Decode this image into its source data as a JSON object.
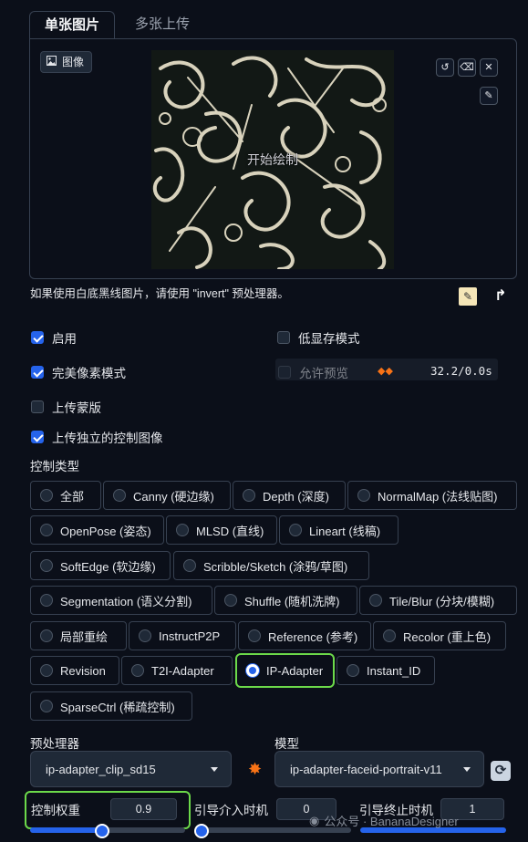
{
  "tabs": {
    "single": "单张图片",
    "multi": "多张上传"
  },
  "image_panel": {
    "label": "图像",
    "canvas_text": "开始绘制"
  },
  "note": "如果使用白底黑线图片，请使用 \"invert\" 预处理器。",
  "checkboxes": {
    "enable": {
      "label": "启用",
      "checked": true
    },
    "low_vram": {
      "label": "低显存模式",
      "checked": false
    },
    "pixel_perfect": {
      "label": "完美像素模式",
      "checked": true
    },
    "allow_preview": {
      "label": "允许预览",
      "checked": false
    },
    "upload_mask": {
      "label": "上传蒙版",
      "checked": false
    },
    "upload_independent": {
      "label": "上传独立的控制图像",
      "checked": true
    }
  },
  "preview_stat": "32.2/0.0s",
  "control_type": {
    "title": "控制类型",
    "options": [
      "全部",
      "Canny (硬边缘)",
      "Depth (深度)",
      "NormalMap (法线贴图)",
      "OpenPose (姿态)",
      "MLSD (直线)",
      "Lineart (线稿)",
      "SoftEdge (软边缘)",
      "Scribble/Sketch (涂鸦/草图)",
      "Segmentation (语义分割)",
      "Shuffle (随机洗牌)",
      "Tile/Blur (分块/模糊)",
      "局部重绘",
      "InstructP2P",
      "Reference (参考)",
      "Recolor (重上色)",
      "Revision",
      "T2I-Adapter",
      "IP-Adapter",
      "Instant_ID",
      "SparseCtrl (稀疏控制)"
    ],
    "selected": "IP-Adapter"
  },
  "preprocessor": {
    "label": "预处理器",
    "value": "ip-adapter_clip_sd15"
  },
  "model": {
    "label": "模型",
    "value": "ip-adapter-faceid-portrait-v11"
  },
  "weight": {
    "label": "控制权重",
    "value": "0.9",
    "fraction": 0.45
  },
  "start": {
    "label": "引导介入时机",
    "value": "0",
    "fraction": 0.0
  },
  "end": {
    "label": "引导终止时机",
    "value": "1",
    "fraction": 1.0
  },
  "watermark": "公众号 · BananaDesigner",
  "colors": {
    "accent": "#2563eb",
    "highlight": "#6cd94a",
    "background": "#0b0f19"
  },
  "icons": [
    "image-icon",
    "undo-icon",
    "eraser-icon",
    "close-icon",
    "brush-icon",
    "edit-icon",
    "upload-arrow-icon",
    "explosion-icon",
    "refresh-icon",
    "wechat-icon",
    "loader-icon"
  ]
}
